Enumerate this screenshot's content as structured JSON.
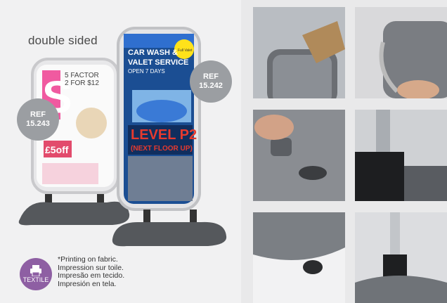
{
  "headline": "double sided",
  "ref_left": {
    "label": "REF",
    "code": "15.243"
  },
  "ref_right": {
    "label": "REF",
    "code": "15.242"
  },
  "poster_left": {
    "big_letter": "S",
    "line1": "5 FACTOR",
    "line2": "2 FOR $12",
    "promo": "£5off"
  },
  "poster_right": {
    "header1": "CAR WASH &",
    "header2": "VALET SERVICE",
    "sub": "OPEN 7 DAYS",
    "badge": "Full Valet",
    "level": "LEVEL P2",
    "next": "(NEXT FLOOR UP)"
  },
  "textile_badge": "TEXTILE",
  "print_notes": [
    "*Printing on fabric.",
    "Impression sur toile.",
    "Impresão em tecido.",
    "Impresión en tela."
  ]
}
